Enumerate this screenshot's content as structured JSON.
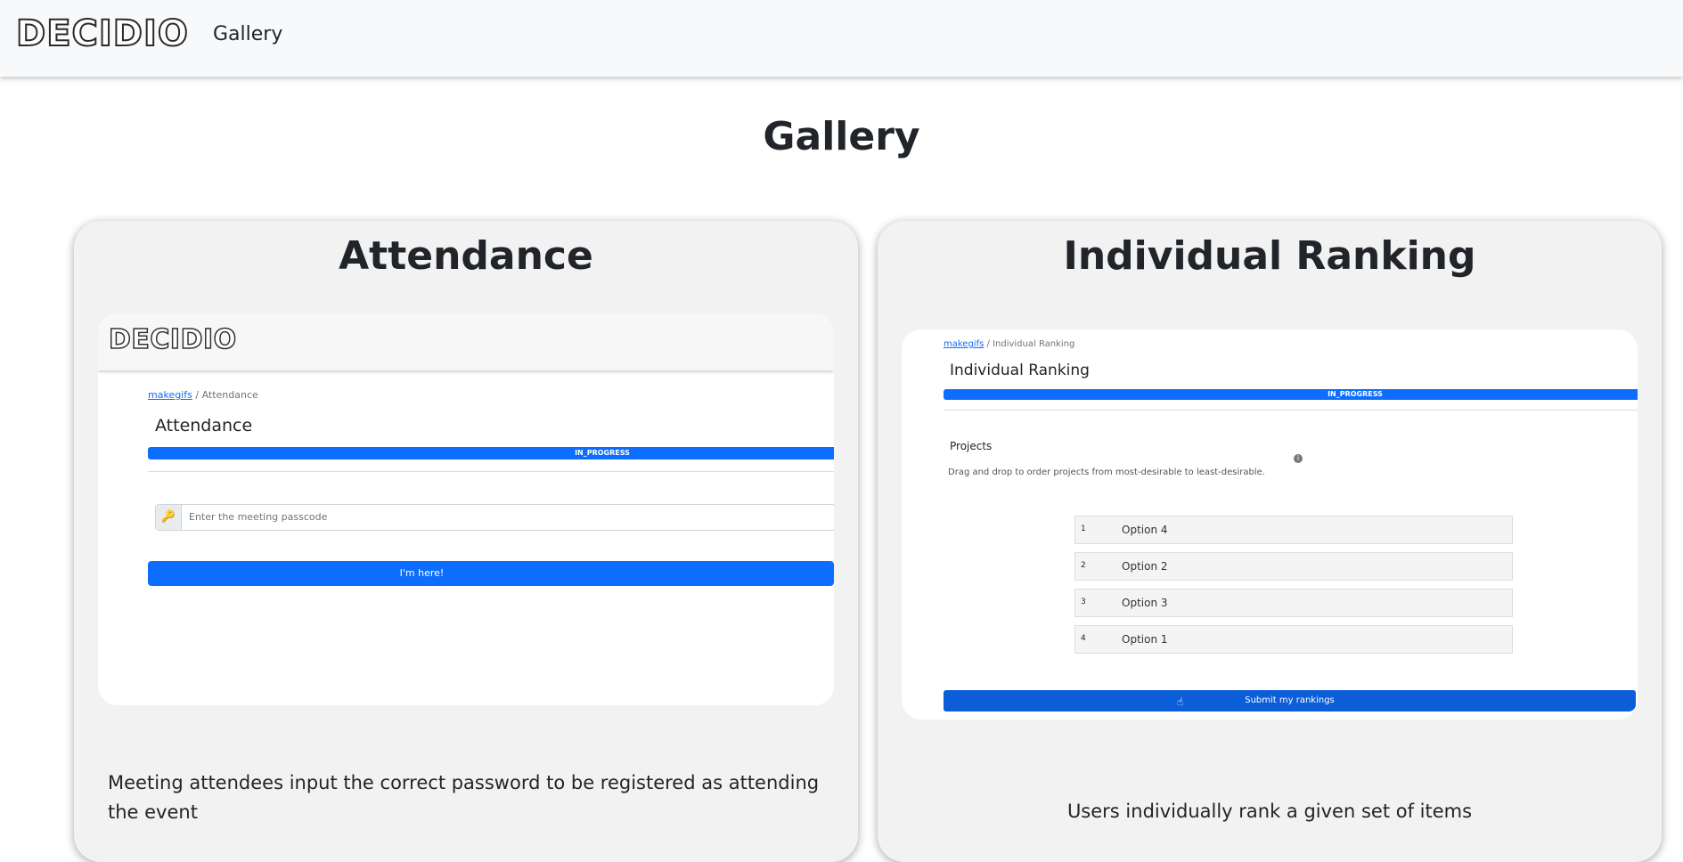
{
  "navbar": {
    "logo": "DECIDIO",
    "gallery_link": "Gallery"
  },
  "page": {
    "title": "Gallery"
  },
  "cards": [
    {
      "title": "Attendance",
      "screenshot": {
        "logo": "DECIDIO",
        "breadcrumb_link": "makegifs",
        "breadcrumb_sep": "/",
        "breadcrumb_current": "Attendance",
        "heading": "Attendance",
        "status": "IN_PROGRESS",
        "passcode_placeholder": "Enter the meeting passcode",
        "button": "I'm here!"
      },
      "description": "Meeting attendees input the correct password to be registered as attending the event"
    },
    {
      "title": "Individual Ranking",
      "screenshot": {
        "breadcrumb_link": "makegifs",
        "breadcrumb_sep": "/",
        "breadcrumb_current": "Individual Ranking",
        "heading": "Individual Ranking",
        "status": "IN_PROGRESS",
        "section_label": "Projects",
        "instructions": "Drag and drop to order projects from most-desirable to least-desirable.",
        "rankings": [
          {
            "rank": "1",
            "label": "Option 4"
          },
          {
            "rank": "2",
            "label": "Option 2"
          },
          {
            "rank": "3",
            "label": "Option 3"
          },
          {
            "rank": "4",
            "label": "Option 1"
          }
        ],
        "button": "Submit my rankings"
      },
      "description": "Users individually rank a given set of items"
    }
  ]
}
